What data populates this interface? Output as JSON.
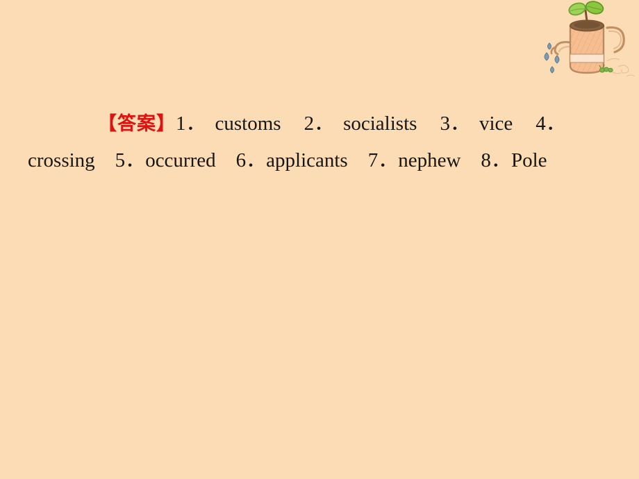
{
  "slide": {
    "background_color": "#fcdcb4",
    "text_color": "#161616",
    "accent_color": "#e0120f"
  },
  "answer_block": {
    "tag": "【答案】",
    "lines": [
      {
        "items": [
          {
            "num": "1",
            "dot": "．",
            "word": "customs"
          },
          {
            "num": "2",
            "dot": "．",
            "word": "socialists"
          },
          {
            "num": "3",
            "dot": "．",
            "word": "vice"
          },
          {
            "num": "4",
            "dot": "．",
            "word": ""
          }
        ]
      },
      {
        "items": [
          {
            "num": "",
            "dot": "",
            "word": "crossing"
          },
          {
            "num": "5",
            "dot": "．",
            "word": "occurred"
          },
          {
            "num": "6",
            "dot": "．",
            "word": "applicants"
          },
          {
            "num": "7",
            "dot": "．",
            "word": "nephew"
          },
          {
            "num": "8",
            "dot": "．",
            "word": "Pole"
          }
        ]
      }
    ],
    "full_text": "【答案】1．customs  2．socialists  3．vice  4．crossing  5．occurred  6．applicants  7．nephew  8．Pole"
  },
  "decoration": {
    "name": "watering-can-with-sprout",
    "can_color": "#f4b98a",
    "can_outline": "#b98a62",
    "soil_color": "#8a6340",
    "leaf_color": "#8cc63f",
    "droplet_color": "#6e8fa6",
    "caterpillar_color": "#7ab648"
  }
}
